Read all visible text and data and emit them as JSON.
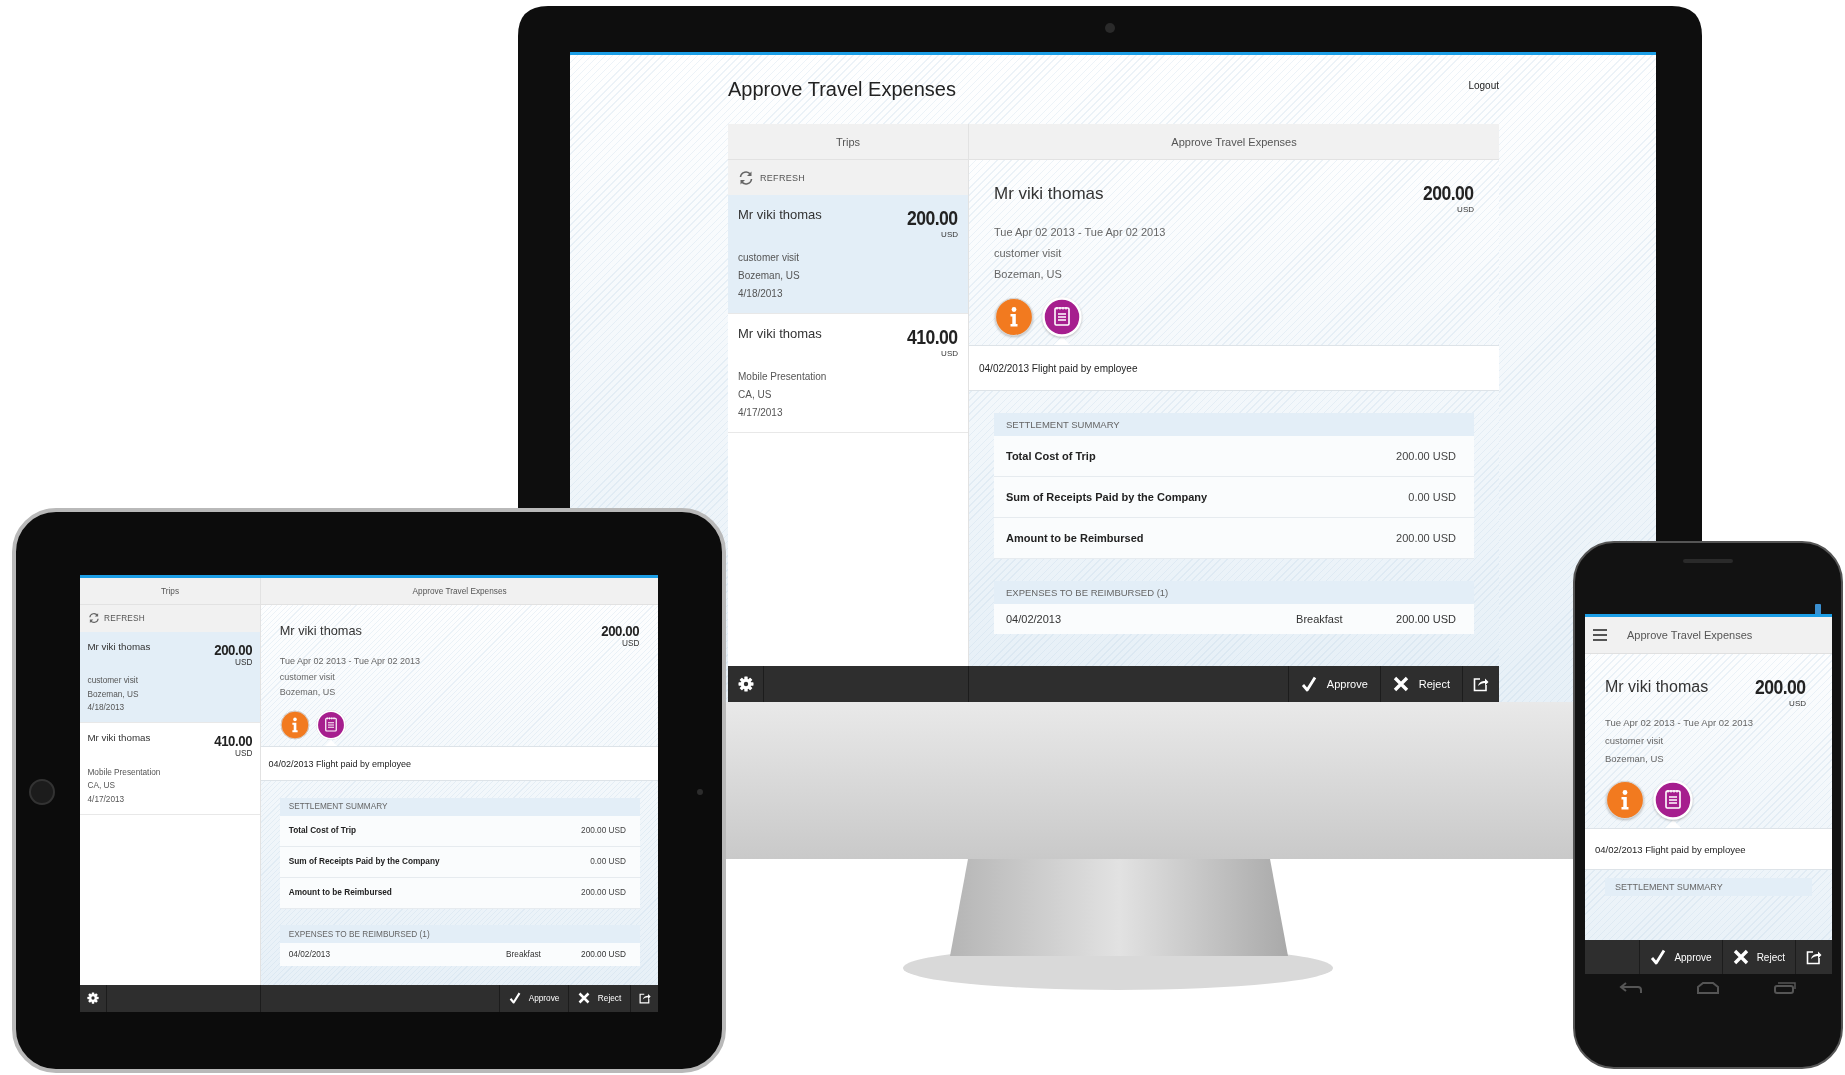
{
  "monitor": {
    "page_title": "Approve Travel Expenses",
    "logout": "Logout",
    "app": {
      "trips_title": "Trips",
      "detail_title": "Approve Travel Expenses",
      "refresh": "REFRESH",
      "trips": [
        {
          "name": "Mr viki thomas",
          "amount": "200.00",
          "currency": "USD",
          "purpose": "customer visit",
          "location": "Bozeman, US",
          "date": "4/18/2013",
          "selected": true
        },
        {
          "name": "Mr viki thomas",
          "amount": "410.00",
          "currency": "USD",
          "purpose": "Mobile Presentation",
          "location": "CA, US",
          "date": "4/17/2013",
          "selected": false
        }
      ],
      "detail": {
        "name": "Mr viki thomas",
        "amount": "200.00",
        "currency": "USD",
        "dates": "Tue Apr 02 2013 - Tue Apr 02 2013",
        "purpose": "customer visit",
        "location": "Bozeman, US",
        "tabs": [
          {
            "kind": "info",
            "selected": false
          },
          {
            "kind": "notes",
            "selected": true
          }
        ],
        "note": "04/02/2013 Flight paid by employee"
      },
      "summary": {
        "title": "SETTLEMENT SUMMARY",
        "rows": [
          {
            "label": "Total Cost of Trip",
            "value": "200.00 USD"
          },
          {
            "label": "Sum of Receipts Paid by the Company",
            "value": "0.00 USD"
          },
          {
            "label": "Amount to be Reimbursed",
            "value": "200.00 USD"
          }
        ]
      },
      "expenses": {
        "title": "EXPENSES TO BE REIMBURSED (1)",
        "rows": [
          {
            "date": "04/02/2013",
            "type": "Breakfast",
            "amount": "200.00 USD"
          }
        ]
      },
      "toolbar": {
        "approve": "Approve",
        "reject": "Reject"
      }
    }
  },
  "tablet": {
    "app": {
      "trips_title": "Trips",
      "detail_title": "Approve Travel Expenses",
      "refresh": "REFRESH",
      "trips": [
        {
          "name": "Mr viki thomas",
          "amount": "200.00",
          "currency": "USD",
          "purpose": "customer visit",
          "location": "Bozeman, US",
          "date": "4/18/2013",
          "selected": true
        },
        {
          "name": "Mr viki thomas",
          "amount": "410.00",
          "currency": "USD",
          "purpose": "Mobile Presentation",
          "location": "CA, US",
          "date": "4/17/2013",
          "selected": false
        }
      ],
      "detail": {
        "name": "Mr viki thomas",
        "amount": "200.00",
        "currency": "USD",
        "dates": "Tue Apr 02 2013 - Tue Apr 02 2013",
        "purpose": "customer visit",
        "location": "Bozeman, US",
        "tabs": [
          {
            "kind": "info",
            "selected": false
          },
          {
            "kind": "notes",
            "selected": true
          }
        ],
        "note": "04/02/2013 Flight paid by employee"
      },
      "summary": {
        "title": "SETTLEMENT SUMMARY",
        "rows": [
          {
            "label": "Total Cost of Trip",
            "value": "200.00 USD"
          },
          {
            "label": "Sum of Receipts Paid by the Company",
            "value": "0.00 USD"
          },
          {
            "label": "Amount to be Reimbursed",
            "value": "200.00 USD"
          }
        ]
      },
      "expenses": {
        "title": "EXPENSES TO BE REIMBURSED (1)",
        "rows": [
          {
            "date": "04/02/2013",
            "type": "Breakfast",
            "amount": "200.00 USD"
          }
        ]
      },
      "toolbar": {
        "approve": "Approve",
        "reject": "Reject"
      }
    }
  },
  "phone": {
    "title": "Approve Travel Expenses",
    "detail": {
      "name": "Mr viki thomas",
      "amount": "200.00",
      "currency": "USD",
      "dates": "Tue Apr 02 2013 - Tue Apr 02 2013",
      "purpose": "customer visit",
      "location": "Bozeman, US",
      "tabs": [
        {
          "kind": "info",
          "selected": false
        },
        {
          "kind": "notes",
          "selected": true
        }
      ],
      "note": "04/02/2013 Flight paid by employee"
    },
    "summary_title": "SETTLEMENT SUMMARY",
    "toolbar": {
      "approve": "Approve",
      "reject": "Reject"
    }
  }
}
